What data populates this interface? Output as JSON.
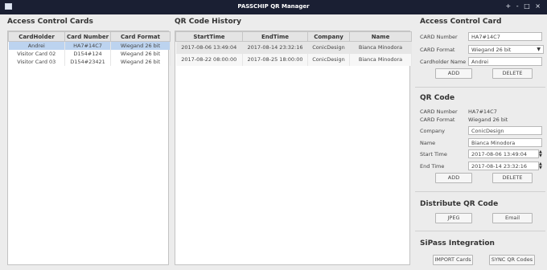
{
  "window": {
    "title": "PASSCHIP QR Manager",
    "controls": "+ - □ ×"
  },
  "cards_panel": {
    "title": "Access Control Cards",
    "columns": [
      "CardHolder",
      "Card Number",
      "Card Format"
    ],
    "rows": [
      [
        "Andrei",
        "HA7#14C7",
        "Wiegand 26 bit"
      ],
      [
        "Visitor Card 02",
        "D154#124",
        "Wiegand 26 bit"
      ],
      [
        "Visitor Card 03",
        "D154#23421",
        "Wiegand 26 bit"
      ]
    ],
    "selected_row": 0
  },
  "qr_history": {
    "title": "QR Code History",
    "columns": [
      "StartTime",
      "EndTime",
      "Company",
      "Name"
    ],
    "rows": [
      [
        "2017-08-06 13:49:04",
        "2017-08-14 23:32:16",
        "ConicDesign",
        "Bianca Minodora"
      ],
      [
        "2017-08-22 08:00:00",
        "2017-08-25 18:00:00",
        "ConicDesign",
        "Bianca Minodora"
      ]
    ]
  },
  "access_card": {
    "title": "Access Control Card",
    "card_number_label": "CARD Number",
    "card_number": "HA7#14C7",
    "card_format_label": "CARD Format",
    "card_format": "Wiegand 26 bit",
    "holder_label": "Cardholder Name",
    "holder": "Andrei",
    "add": "ADD",
    "delete": "DELETE"
  },
  "qr_code": {
    "title": "QR Code",
    "card_number_label": "CARD Number",
    "card_number": "HA7#14C7",
    "card_format_label": "CARD Format",
    "card_format": "Wiegand 26 bit",
    "company_label": "Company",
    "company": "ConicDesign",
    "name_label": "Name",
    "name": "Bianca Minodora",
    "start_label": "Start Time",
    "start": "2017-08-06 13:49:04",
    "end_label": "End Time",
    "end": "2017-08-14 23:32:16",
    "add": "ADD",
    "delete": "DELETE"
  },
  "distribute": {
    "title": "Distribute QR Code",
    "jpeg": "JPEG",
    "email": "Email"
  },
  "sipass": {
    "title": "SiPass Integration",
    "import": "IMPORT Cards",
    "sync": "SYNC QR Codes"
  }
}
